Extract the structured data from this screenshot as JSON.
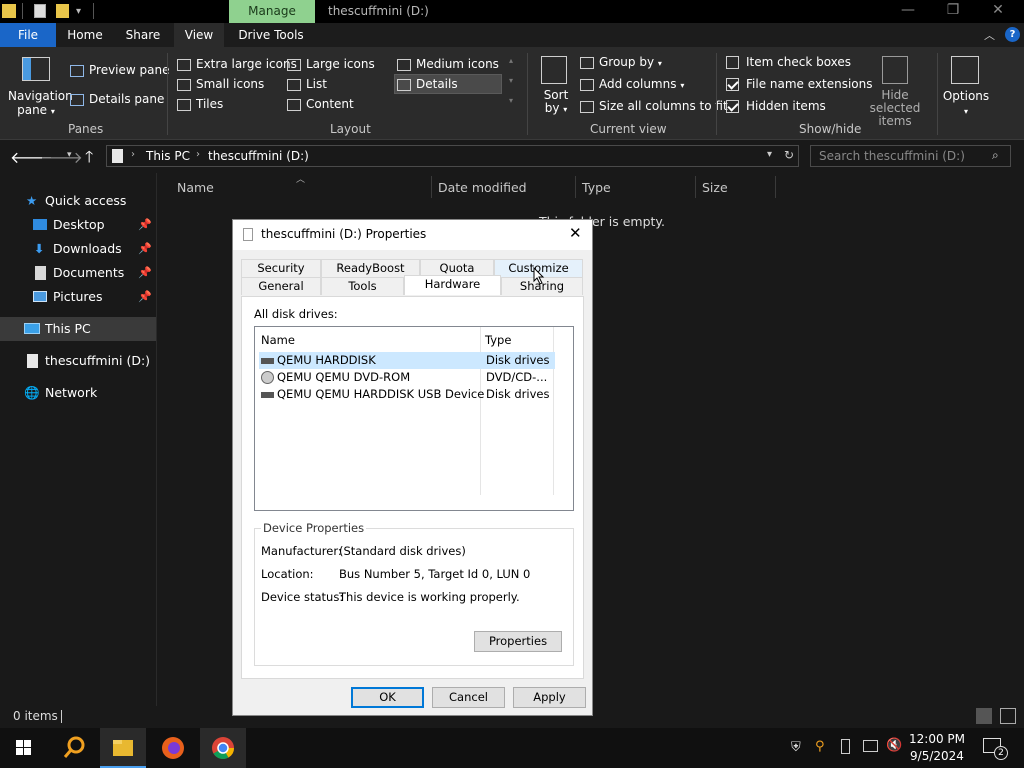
{
  "window": {
    "title": "thescuffmini (D:)",
    "manage_tab": "Manage"
  },
  "ribbon_tabs": [
    "File",
    "Home",
    "Share",
    "View",
    "Drive Tools"
  ],
  "ribbon": {
    "panes": {
      "navigation_pane": "Navigation pane",
      "preview_pane": "Preview pane",
      "details_pane": "Details pane",
      "group_label": "Panes"
    },
    "layout": {
      "items": [
        "Extra large icons",
        "Large icons",
        "Medium icons",
        "Small icons",
        "List",
        "Details",
        "Tiles",
        "Content"
      ],
      "selected": "Details",
      "group_label": "Layout"
    },
    "current_view": {
      "sort_by": "Sort by",
      "group_by": "Group by",
      "add_columns": "Add columns",
      "size_all_columns": "Size all columns to fit",
      "group_label": "Current view"
    },
    "show_hide": {
      "item_check_boxes": "Item check boxes",
      "item_check_boxes_checked": false,
      "file_name_extensions": "File name extensions",
      "file_name_extensions_checked": true,
      "hidden_items": "Hidden items",
      "hidden_items_checked": true,
      "hide_selected_items": "Hide selected items",
      "group_label": "Show/hide"
    },
    "options": "Options"
  },
  "address": {
    "crumbs": [
      "This PC",
      "thescuffmini (D:)"
    ],
    "search_placeholder": "Search thescuffmini (D:)"
  },
  "nav": {
    "quick_access": "Quick access",
    "items": [
      {
        "label": "Desktop",
        "pinned": true
      },
      {
        "label": "Downloads",
        "pinned": true
      },
      {
        "label": "Documents",
        "pinned": true
      },
      {
        "label": "Pictures",
        "pinned": true
      }
    ],
    "this_pc": "This PC",
    "drive": "thescuffmini (D:)",
    "network": "Network"
  },
  "content": {
    "columns": [
      "Name",
      "Date modified",
      "Type",
      "Size"
    ],
    "empty_message": "This folder is empty."
  },
  "status": {
    "items": "0 items"
  },
  "taskbar": {
    "time": "12:00 PM",
    "date": "9/5/2024",
    "notifications": "2"
  },
  "dialog": {
    "title": "thescuffmini (D:) Properties",
    "tabs_row1": [
      "Security",
      "ReadyBoost",
      "Quota",
      "Customize"
    ],
    "tabs_row2": [
      "General",
      "Tools",
      "Hardware",
      "Sharing"
    ],
    "active_tab": "Hardware",
    "all_disk_drives": "All disk drives:",
    "list_headers": [
      "Name",
      "Type"
    ],
    "drives": [
      {
        "name": "QEMU HARDDISK",
        "type": "Disk drives"
      },
      {
        "name": "QEMU QEMU DVD-ROM",
        "type": "DVD/CD-..."
      },
      {
        "name": "QEMU QEMU HARDDISK USB Device",
        "type": "Disk drives"
      }
    ],
    "device_properties": {
      "legend": "Device Properties",
      "manufacturer_label": "Manufacturer:",
      "manufacturer": "(Standard disk drives)",
      "location_label": "Location:",
      "location": "Bus Number 5, Target Id 0, LUN 0",
      "status_label": "Device status:",
      "status": "This device is working properly.",
      "properties_button": "Properties"
    },
    "buttons": {
      "ok": "OK",
      "cancel": "Cancel",
      "apply": "Apply"
    }
  }
}
